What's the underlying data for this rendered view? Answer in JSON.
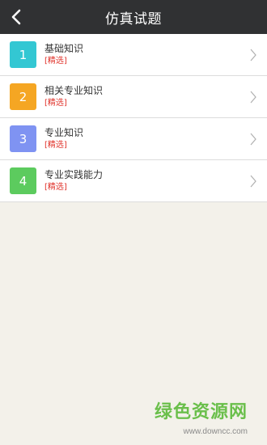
{
  "header": {
    "title": "仿真试题"
  },
  "items": [
    {
      "number": "1",
      "name": "基础知识",
      "tag": "[精选]",
      "color": "#33c7d3"
    },
    {
      "number": "2",
      "name": "相关专业知识",
      "tag": "[精选]",
      "color": "#f5a623"
    },
    {
      "number": "3",
      "name": "专业知识",
      "tag": "[精选]",
      "color": "#7f93f2"
    },
    {
      "number": "4",
      "name": "专业实践能力",
      "tag": "[精选]",
      "color": "#5ccb5e"
    }
  ],
  "watermark": {
    "text": "绿色资源网",
    "url": "www.downcc.com"
  }
}
